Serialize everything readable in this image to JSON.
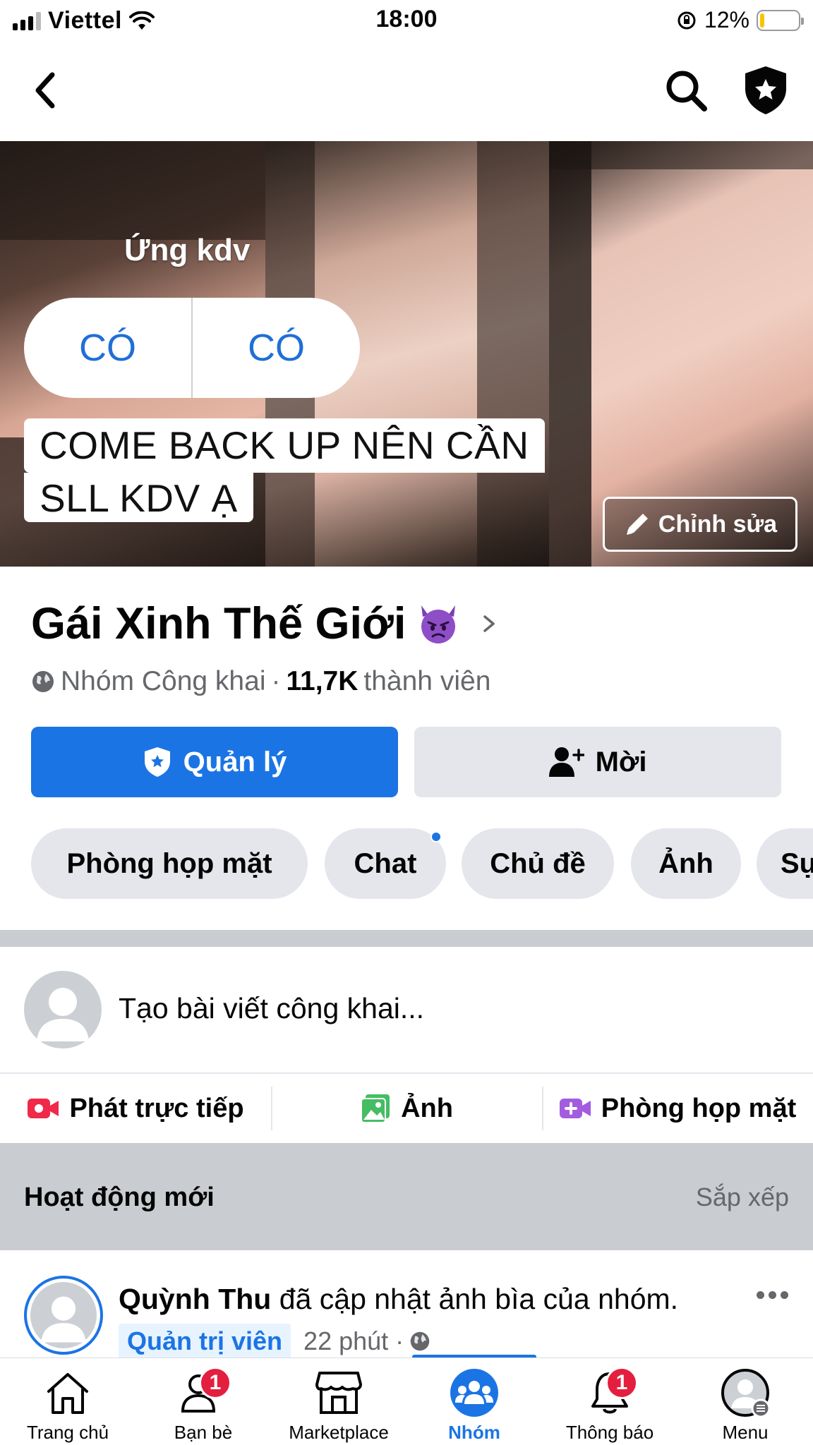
{
  "status_bar": {
    "carrier": "Viettel",
    "time": "18:00",
    "battery_percent": "12%",
    "battery_level": 0.12
  },
  "nav": {
    "icons": [
      "chevron-left-icon",
      "search-icon",
      "admin-shield-star-icon"
    ]
  },
  "cover": {
    "poll_question": "Ứng kdv",
    "poll_options": [
      "CÓ",
      "CÓ"
    ],
    "caption_line1": "COME BACK UP NÊN CẦN",
    "caption_line2": "SLL KDV Ạ",
    "edit_label": "Chỉnh sửa"
  },
  "group": {
    "name": "Gái Xinh Thế Giới",
    "privacy": "Nhóm Công khai",
    "member_count": "11,7K",
    "member_label": "thành viên"
  },
  "buttons": {
    "manage": "Quản lý",
    "invite": "Mời"
  },
  "chips": [
    "Phòng họp mặt",
    "Chat",
    "Chủ đề",
    "Ảnh",
    "Sự kiện"
  ],
  "composer": {
    "placeholder": "Tạo bài viết công khai...",
    "actions": [
      "Phát trực tiếp",
      "Ảnh",
      "Phòng họp mặt"
    ]
  },
  "feed": {
    "title": "Hoạt động mới",
    "sort_label": "Sắp xếp"
  },
  "post": {
    "author": "Quỳnh Thu",
    "action_text": "đã cập nhật ảnh bìa của nhóm.",
    "role": "Quản trị viên",
    "time": "22 phút ·"
  },
  "tab_bar": {
    "tabs": [
      {
        "label": "Trang chủ",
        "icon": "home-icon"
      },
      {
        "label": "Bạn bè",
        "icon": "friends-icon",
        "badge": "1"
      },
      {
        "label": "Marketplace",
        "icon": "marketplace-icon"
      },
      {
        "label": "Nhóm",
        "icon": "groups-icon",
        "active": true
      },
      {
        "label": "Thông báo",
        "icon": "bell-icon",
        "badge": "1"
      },
      {
        "label": "Menu",
        "icon": "profile-menu-icon"
      }
    ]
  },
  "colors": {
    "accent": "#1b74e4",
    "badge_red": "#e41e3f",
    "chip_bg": "#e4e6eb",
    "secondary_text": "#65676b"
  }
}
